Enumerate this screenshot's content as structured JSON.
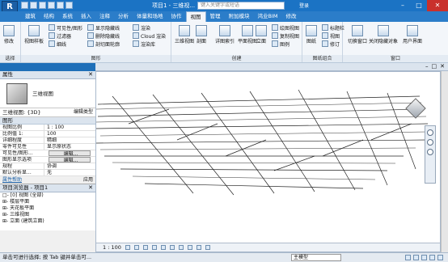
{
  "app": {
    "logo": "R",
    "doc_title": "项目1 - 三维视...",
    "search_placeholder": "键入关键字或短语",
    "signin": "登录",
    "window_controls": [
      "–",
      "□",
      "✕"
    ]
  },
  "tabs": [
    "建筑",
    "结构",
    "系统",
    "插入",
    "注释",
    "分析",
    "体量和场地",
    "协作",
    "视图",
    "管理",
    "附加模块",
    "鸿业BIM",
    "修改"
  ],
  "active_tab_index": 8,
  "ribbon": {
    "modify": "修改",
    "select": "选择",
    "graphics_panel": "图形",
    "create_panel": "创建",
    "sheet_panel": "图纸组合",
    "windows_panel": "窗口",
    "graphics_items": [
      "视图样板",
      "可见性/图形",
      "过滤器",
      "细线",
      "显示隐藏线",
      "删除隐藏线",
      "剖切面轮廓",
      "渲染",
      "Cloud 渲染",
      "渲染库"
    ],
    "create_items": [
      "三维视图",
      "剖面",
      "详图索引",
      "平面视图",
      "立面",
      "绘图视图",
      "复制视图",
      "图例",
      "明细表",
      "范围框"
    ],
    "sheet_items": [
      "图纸",
      "标题栏",
      "视图",
      "修订"
    ],
    "window_items": [
      "切换窗口",
      "关闭隐藏对象",
      "用户界面"
    ]
  },
  "view_tab": {
    "controls": [
      "–",
      "□",
      "✕"
    ]
  },
  "properties": {
    "title": "属性",
    "close": "✕",
    "type_name": "三维视图",
    "view_selector": "三维视图: {3D}",
    "edit_type": "编辑类型",
    "section": "图形",
    "rows": [
      {
        "k": "视图比例",
        "v": "1 : 100"
      },
      {
        "k": "比例值 1:",
        "v": "100"
      },
      {
        "k": "详细程度",
        "v": "精细"
      },
      {
        "k": "零件可见性",
        "v": "显示原状态"
      },
      {
        "k": "可见性/图形...",
        "v": "编辑..."
      },
      {
        "k": "图形显示选项",
        "v": "编辑..."
      },
      {
        "k": "规程",
        "v": "协调"
      },
      {
        "k": "默认分析显...",
        "v": "无"
      }
    ],
    "help": "属性帮助",
    "apply": "应用"
  },
  "browser": {
    "title": "项目浏览器 - 项目1",
    "close": "✕",
    "items": [
      "□- [0] 视图 (全部)",
      "  ⊞- 楼层平面",
      "  ⊞- 天花板平面",
      "  ⊞- 三维视图",
      "  ⊞- 立面 (建筑立面)"
    ]
  },
  "viewbar": {
    "scale": "1 : 100"
  },
  "status": {
    "text": "单击可进行选择; 按 Tab 键并单击可...",
    "model": "主模型"
  }
}
